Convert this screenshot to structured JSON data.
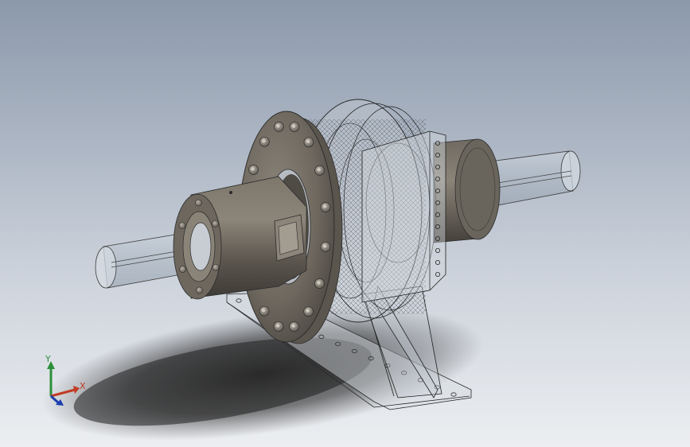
{
  "viewport": {
    "background_top": "#8c99ab",
    "background_bottom": "#eceef1"
  },
  "model": {
    "shaft_color": "#b7c3ce",
    "housing_color": "#5f5a52",
    "housing_highlight": "#8c8579",
    "bolt_color": "#8a857c",
    "transparent_part_color": "#c7ccd3",
    "wire_color": "#1d1d1d"
  },
  "triad": {
    "x_label": "X",
    "y_label": "Y",
    "x_color": "#c23b22",
    "y_color": "#2e8f3b",
    "z_color": "#1c3fae"
  }
}
